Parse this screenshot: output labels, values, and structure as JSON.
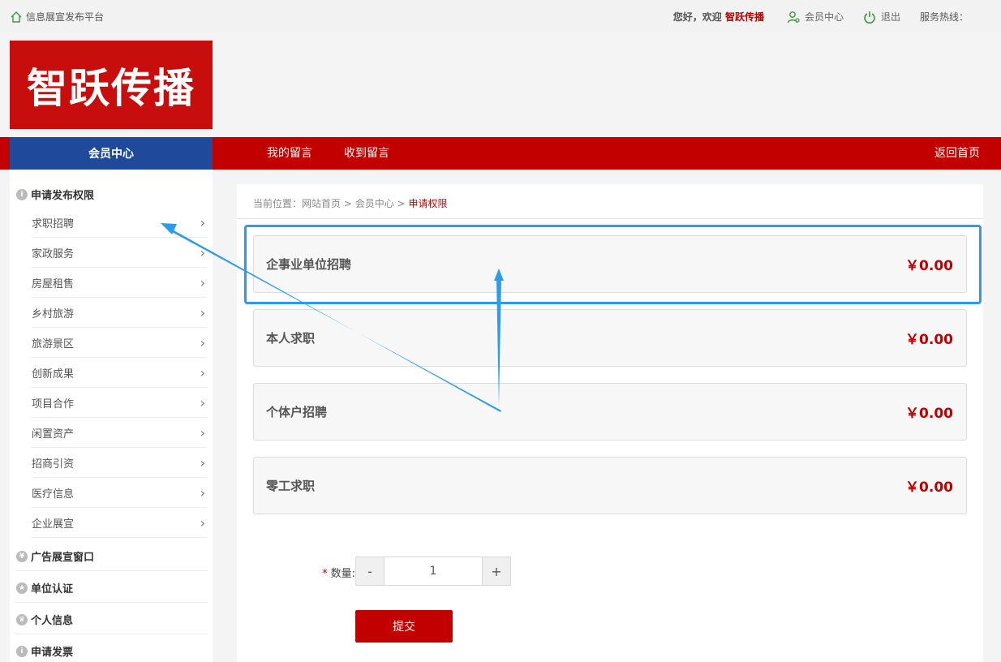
{
  "topbar": {
    "home_label": "信息展宣发布平台",
    "greet_prefix": "您好，欢迎",
    "user_name": "智跃传播",
    "member_center": "会员中心",
    "logout": "退出",
    "hotline": "服务热线："
  },
  "logo": {
    "text": "智跃传播"
  },
  "nav": {
    "member_center": "会员中心",
    "my_messages": "我的留言",
    "received_messages": "收到留言",
    "back_home": "返回首页"
  },
  "sidebar": {
    "sections": [
      {
        "label": "申请发布权限",
        "icon": "info-icon"
      },
      {
        "label": "广告展宣窗口",
        "icon": "yen-icon"
      },
      {
        "label": "单位认证",
        "icon": "star-icon"
      },
      {
        "label": "个人信息",
        "icon": "crown-icon"
      },
      {
        "label": "申请发票",
        "icon": "info-icon"
      }
    ],
    "items": [
      "求职招聘",
      "家政服务",
      "房屋租售",
      "乡村旅游",
      "旅游景区",
      "创新成果",
      "项目合作",
      "闲置资产",
      "招商引资",
      "医疗信息",
      "企业展宣"
    ]
  },
  "breadcrumb": {
    "prefix": "当前位置：",
    "home": "网站首页",
    "sep": ">",
    "member": "会员中心",
    "current": "申请权限"
  },
  "options": [
    {
      "name": "企事业单位招聘",
      "price": "￥0.00"
    },
    {
      "name": "本人求职",
      "price": "￥0.00"
    },
    {
      "name": "个体户招聘",
      "price": "￥0.00"
    },
    {
      "name": "零工求职",
      "price": "￥0.00"
    }
  ],
  "quantity": {
    "required_mark": "*",
    "label": "数量:",
    "minus": "-",
    "value": "1",
    "plus": "+"
  },
  "submit_label": "提交",
  "colors": {
    "brand_red": "#c30000",
    "nav_blue": "#1f4a9c",
    "annotation_blue": "#2b9bea"
  }
}
